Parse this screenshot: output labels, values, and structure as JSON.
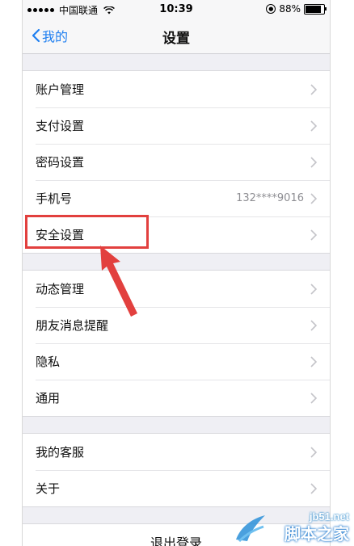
{
  "status_bar": {
    "carrier": "中国联通",
    "time": "10:39",
    "battery_percent": "88%",
    "battery_level": 0.88
  },
  "nav": {
    "back_label": "我的",
    "title": "设置"
  },
  "groups": [
    {
      "items": [
        {
          "label": "账户管理",
          "value": ""
        },
        {
          "label": "支付设置",
          "value": ""
        },
        {
          "label": "密码设置",
          "value": ""
        },
        {
          "label": "手机号",
          "value": "132****9016"
        },
        {
          "label": "安全设置",
          "value": ""
        }
      ]
    },
    {
      "items": [
        {
          "label": "动态管理",
          "value": ""
        },
        {
          "label": "朋友消息提醒",
          "value": ""
        },
        {
          "label": "隐私",
          "value": ""
        },
        {
          "label": "通用",
          "value": ""
        }
      ]
    },
    {
      "items": [
        {
          "label": "我的客服",
          "value": ""
        },
        {
          "label": "关于",
          "value": ""
        }
      ]
    }
  ],
  "logout_label": "退出登录",
  "watermark": {
    "domain": "jb51.net",
    "site": "脚本之家"
  },
  "colors": {
    "accent": "#1f7ff0",
    "highlight": "#e2403e"
  }
}
